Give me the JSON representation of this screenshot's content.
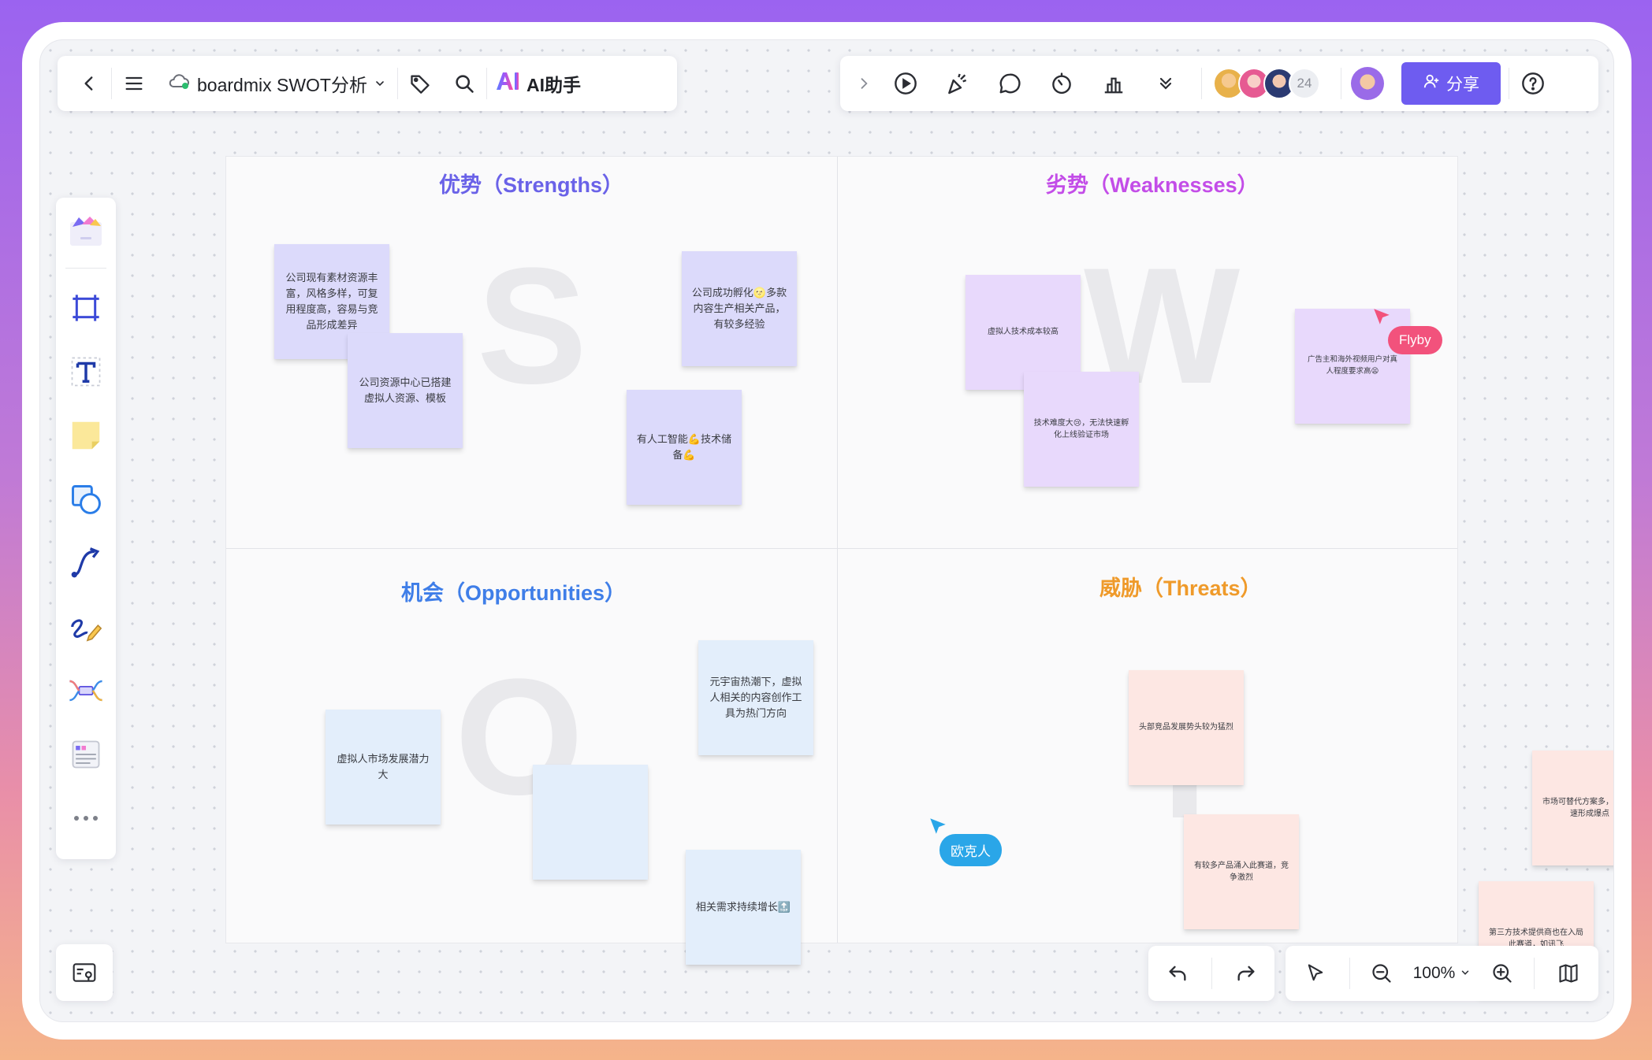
{
  "colors": {
    "accent": "#6e5cf0",
    "strengths": "#6a62e8",
    "weaknesses": "#c34de8",
    "opportunities": "#3f7ee8",
    "threats": "#ef9a2a",
    "flyby_cursor": "#f2527c",
    "oukeren_cursor": "#2aa6e8"
  },
  "toolbar_left": {
    "back_icon": "chevron-left-icon",
    "menu_icon": "hamburger-menu-icon",
    "cloud_icon": "cloud-sync-icon",
    "doc_title": "boardmix SWOT分析",
    "tag_icon": "tag-icon",
    "search_icon": "search-icon",
    "ai_label": "AI助手"
  },
  "toolbar_right": {
    "icons": [
      "chevron-right-icon",
      "play-icon",
      "celebrate-icon",
      "comment-icon",
      "timer-icon",
      "vote-icon",
      "more-down-icon"
    ],
    "collaborator_count": "24",
    "share_label": "分享",
    "help_icon": "help-icon"
  },
  "sidebar": {
    "tools": [
      "template-icon",
      "frame-icon",
      "text-icon",
      "sticky-note-icon",
      "shape-icon",
      "connector-icon",
      "pen-icon",
      "mindmap-icon",
      "table-icon",
      "more-icon"
    ]
  },
  "board": {
    "quadrants": {
      "strengths": {
        "title": "优势（Strengths）",
        "letter": "S"
      },
      "weaknesses": {
        "title": "劣势（Weaknesses）",
        "letter": "W"
      },
      "opportunities": {
        "title": "机会（Opportunities）",
        "letter": "O"
      },
      "threats": {
        "title": "威胁（Threats）",
        "letter": "T"
      }
    },
    "notes": {
      "s1": "公司现有素材资源丰富，风格多样，可复用程度高，容易与竞品形成差异",
      "s2": "公司资源中心已搭建虚拟人资源、模板",
      "s3": "公司成功孵化🌝多款内容生产相关产品，有较多经验",
      "s4": "有人工智能💪技术储备💪",
      "w1": "虚拟人技术成本较高",
      "w2": "技术难度大😢，无法快速孵化上线验证市场",
      "w3": "广告主和海外视频用户对真人程度要求高😫",
      "o1": "虚拟人市场发展潜力大",
      "o2": "元宇宙热潮下，虚拟人相关的内容创作工具为热门方向",
      "o3": "",
      "o4": "相关需求持续增长🔝",
      "t1": "头部竞品发展势头较为猛烈",
      "t2": "有较多产品涌入此赛道，竞争激烈",
      "t3": "市场可替代方案多，需开快速形成爆点",
      "t4": "第三方技术提供商也在入局此赛道，如讯飞"
    },
    "cursors": {
      "flyby": "Flyby",
      "oukeren": "欧克人"
    }
  },
  "bottom": {
    "undo_icon": "undo-icon",
    "redo_icon": "redo-icon",
    "select_icon": "pointer-icon",
    "zoom_out_icon": "zoom-out-icon",
    "zoom_level": "100%",
    "zoom_in_icon": "zoom-in-icon",
    "book_icon": "guide-book-icon",
    "minimap_icon": "minimap-icon"
  }
}
